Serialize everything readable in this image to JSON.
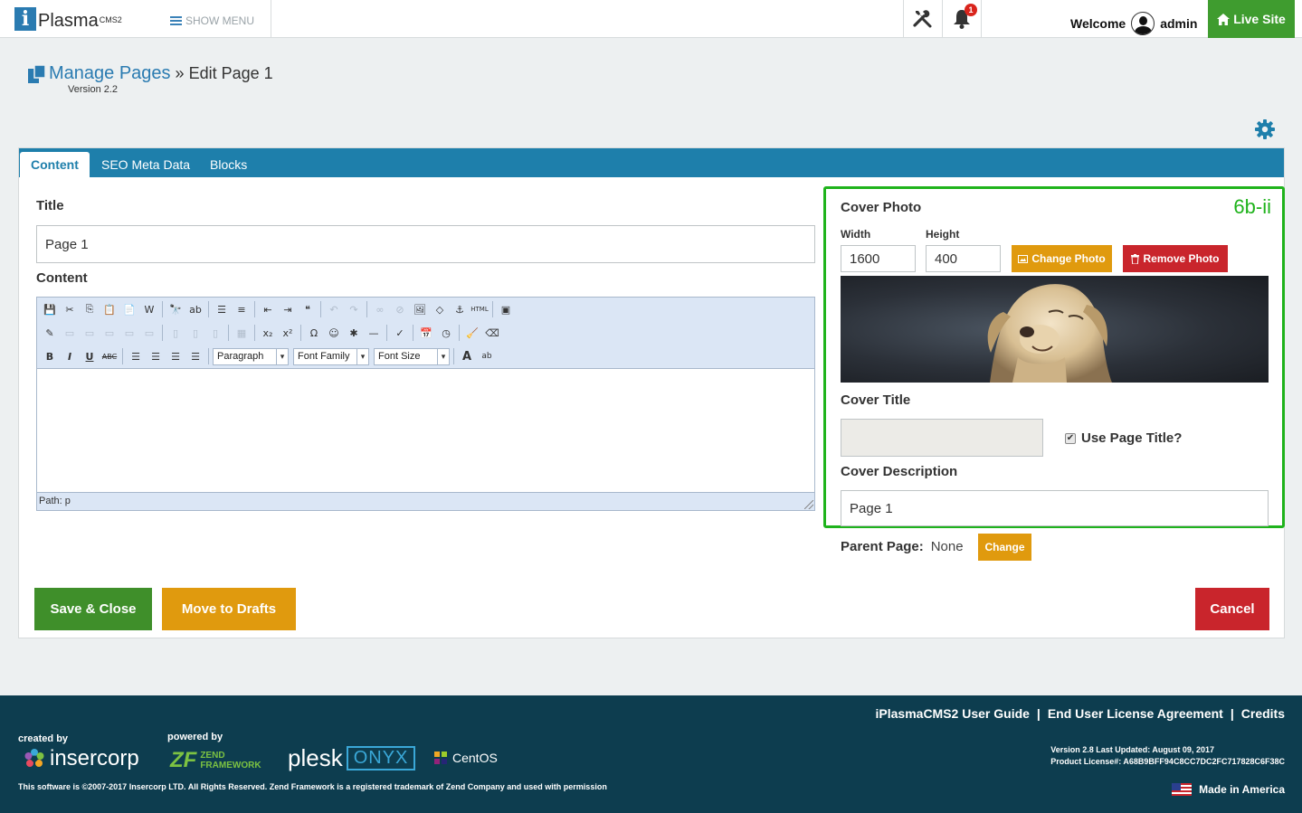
{
  "header": {
    "logo_text": "Plasma",
    "logo_sup": "CMS2",
    "show_menu_label": "SHOW MENU",
    "notification_count": "1",
    "welcome_label": "Welcome",
    "username": "admin",
    "live_site_label": "Live Site"
  },
  "breadcrumb": {
    "parent": "Manage Pages",
    "separator": "»",
    "current": "Edit Page 1",
    "version": "Version 2.2"
  },
  "tabs": [
    {
      "label": "Content"
    },
    {
      "label": "SEO Meta Data"
    },
    {
      "label": "Blocks"
    }
  ],
  "form": {
    "title_label": "Title",
    "title_value": "Page 1",
    "content_label": "Content",
    "editor": {
      "format_select": "Paragraph",
      "font_family_select": "Font Family",
      "font_size_select": "Font Size",
      "path_text": "Path: p"
    }
  },
  "cover": {
    "annotation": "6b-ii",
    "heading": "Cover Photo",
    "width_label": "Width",
    "width_value": "1600",
    "height_label": "Height",
    "height_value": "400",
    "change_photo_label": "Change Photo",
    "remove_photo_label": "Remove Photo",
    "cover_title_label": "Cover Title",
    "cover_title_value": "",
    "use_page_title_label": "Use Page Title?",
    "use_page_title_checked": true,
    "cover_description_label": "Cover Description",
    "cover_description_value": "Page 1"
  },
  "parent_page": {
    "label": "Parent Page:",
    "value": "None",
    "change_label": "Change"
  },
  "actions": {
    "save_close": "Save & Close",
    "move_drafts": "Move to Drafts",
    "cancel": "Cancel"
  },
  "footer": {
    "links": [
      "iPlasmaCMS2 User Guide",
      "End User License Agreement",
      "Credits"
    ],
    "link_separator": "|",
    "created_by_label": "created by",
    "created_by_name": "insercorp",
    "powered_by_label": "powered by",
    "zend_label": "ZEND FRAMEWORK",
    "plesk_label": "plesk",
    "onyx_label": "ONYX",
    "centos_label": "CentOS",
    "copyright": "This software is ©2007-2017 Insercorp LTD. All Rights Reserved. Zend Framework is a registered trademark of Zend Company and used with permission",
    "version_line": "Version 2.8 Last Updated: August 09, 2017",
    "license_line": "Product License#: A68B9BFF94C8CC7DC2FC717828C6F38C",
    "made_in": "Made in America"
  },
  "colors": {
    "primary_blue": "#1e7fab",
    "success_green": "#3f8f2a",
    "warning_orange": "#e09a0e",
    "danger_red": "#c9252c",
    "annotation_green": "#1fb31c",
    "footer_bg": "#0d3d4f"
  }
}
